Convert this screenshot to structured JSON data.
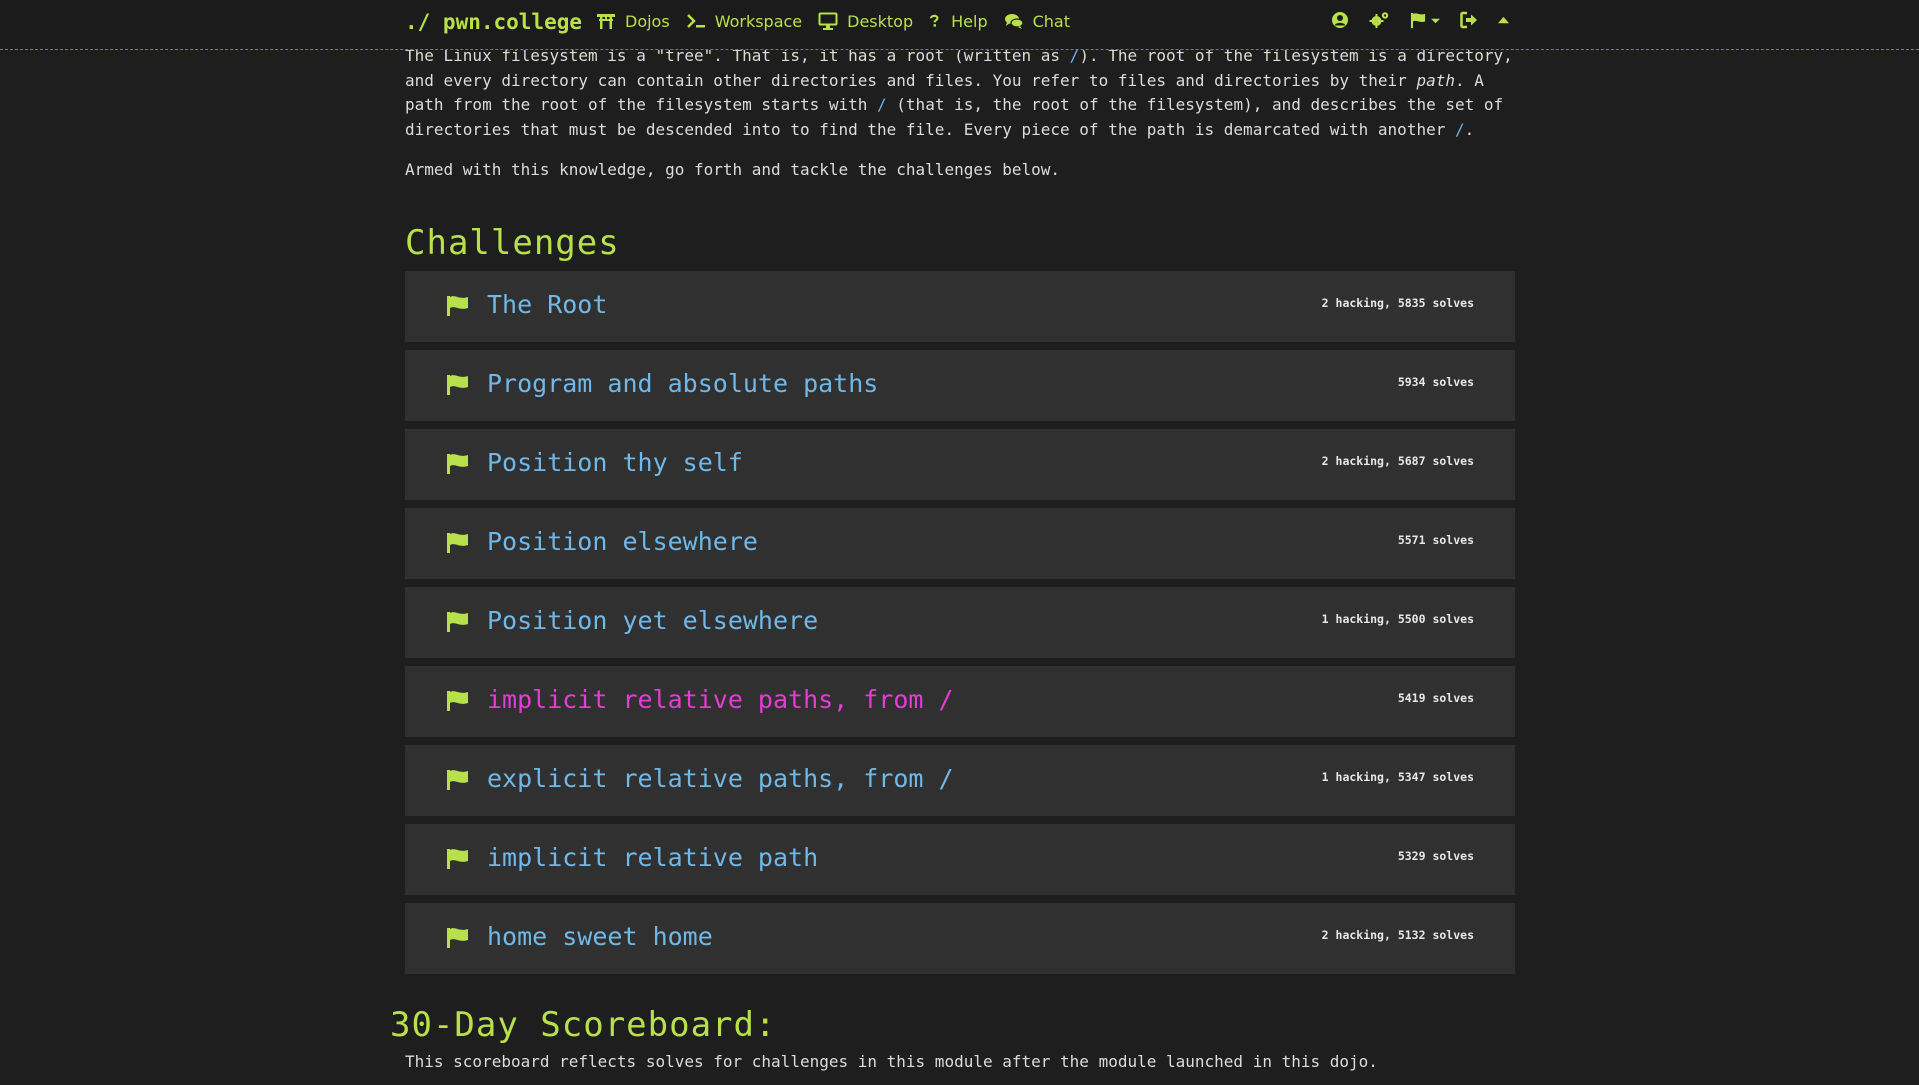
{
  "navbar": {
    "brand": "./ pwn.college",
    "links": [
      {
        "label": "Dojos",
        "icon": "torii-gate-icon"
      },
      {
        "label": "Workspace",
        "icon": "terminal-icon"
      },
      {
        "label": "Desktop",
        "icon": "desktop-icon"
      },
      {
        "label": "Help",
        "icon": "question-icon"
      },
      {
        "label": "Chat",
        "icon": "comments-icon"
      }
    ],
    "right_icons": [
      "user-circle-icon",
      "settings-icon",
      "flag-dropdown-icon",
      "logout-icon",
      "caret-up-icon"
    ]
  },
  "intro": {
    "p1_a": "The Linux filesystem is a \"tree\". That is, it has a root (written as ",
    "p1_code1": "/",
    "p1_b": "). The root of the filesystem is a directory,\nand every directory can contain other directories and files. You refer to files and directories by their ",
    "p1_em": "path",
    "p1_c": ". A\npath from the root of the filesystem starts with ",
    "p1_code2": "/",
    "p1_d": " (that is, the root of the filesystem), and describes the set of\ndirectories that must be descended into to find the file. Every piece of the path is demarcated with another ",
    "p1_code3": "/",
    "p1_e": ".",
    "p2": "Armed with this knowledge, go forth and tackle the challenges below."
  },
  "challenges_title": "Challenges",
  "challenges": [
    {
      "title": "The Root",
      "stats": "2 hacking, 5835 solves",
      "active": false
    },
    {
      "title": "Program and absolute paths",
      "stats": "5934 solves",
      "active": false
    },
    {
      "title": "Position thy self",
      "stats": "2 hacking, 5687 solves",
      "active": false
    },
    {
      "title": "Position elsewhere",
      "stats": "5571 solves",
      "active": false
    },
    {
      "title": "Position yet elsewhere",
      "stats": "1 hacking, 5500 solves",
      "active": false
    },
    {
      "title": "implicit relative paths, from /",
      "stats": "5419 solves",
      "active": true
    },
    {
      "title": "explicit relative paths, from /",
      "stats": "1 hacking, 5347 solves",
      "active": false
    },
    {
      "title": "implicit relative path",
      "stats": "5329 solves",
      "active": false
    },
    {
      "title": "home sweet home",
      "stats": "2 hacking, 5132 solves",
      "active": false
    }
  ],
  "scoreboard": {
    "title": "30-Day Scoreboard:",
    "description": "This scoreboard reflects solves for challenges in this module after the module launched in this dojo."
  },
  "colors": {
    "accent": "#b7e04a",
    "link": "#6fb8e8",
    "active": "#e83ad7",
    "background": "#1e1e1e",
    "card": "#303030"
  }
}
